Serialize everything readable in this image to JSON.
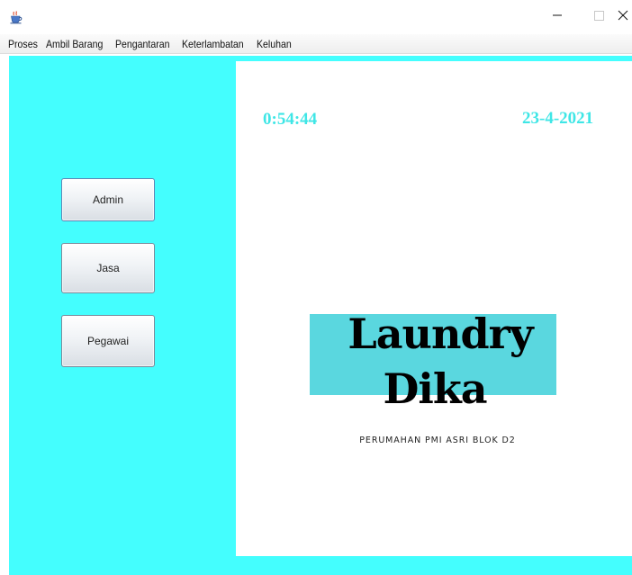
{
  "window": {
    "icon": "java-coffee-cup-icon",
    "controls": {
      "minimize_icon": "minimize-icon",
      "maximize_icon": "maximize-icon",
      "close_icon": "close-icon"
    }
  },
  "menubar": {
    "items": [
      {
        "label": "Proses"
      },
      {
        "label": "Ambil Barang"
      },
      {
        "label": "Pengantaran"
      },
      {
        "label": "Keterlambatan"
      },
      {
        "label": "Keluhan"
      }
    ]
  },
  "sidebar": {
    "buttons": [
      {
        "label": "Admin"
      },
      {
        "label": "Jasa"
      },
      {
        "label": "Pegawai"
      }
    ]
  },
  "panel": {
    "clock": "0:54:44",
    "date": "23-4-2021",
    "logo_line1": "Laundry",
    "logo_line2": "Dika",
    "address": "PERUMAHAN PMI ASRI BLOK D2"
  },
  "colors": {
    "background_cyan": "#44fefe",
    "clock_text": "#3fe6e6",
    "logo_box": "#5ad7df",
    "panel": "#ffffff"
  }
}
